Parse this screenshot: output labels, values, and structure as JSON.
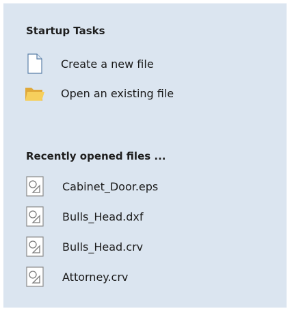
{
  "startup": {
    "heading": "Startup Tasks",
    "tasks": [
      {
        "label": "Create a new file",
        "icon": "new-file-icon"
      },
      {
        "label": "Open an existing file",
        "icon": "folder-open-icon"
      }
    ]
  },
  "recent": {
    "heading": "Recently opened files ...",
    "files": [
      {
        "label": "Cabinet_Door.eps",
        "icon": "vector-file-icon"
      },
      {
        "label": "Bulls_Head.dxf",
        "icon": "vector-file-icon"
      },
      {
        "label": "Bulls_Head.crv",
        "icon": "vector-file-icon"
      },
      {
        "label": "Attorney.crv",
        "icon": "vector-file-icon"
      }
    ]
  },
  "colors": {
    "panel_background": "#dbe5f0",
    "folder": "#f2c94c"
  }
}
